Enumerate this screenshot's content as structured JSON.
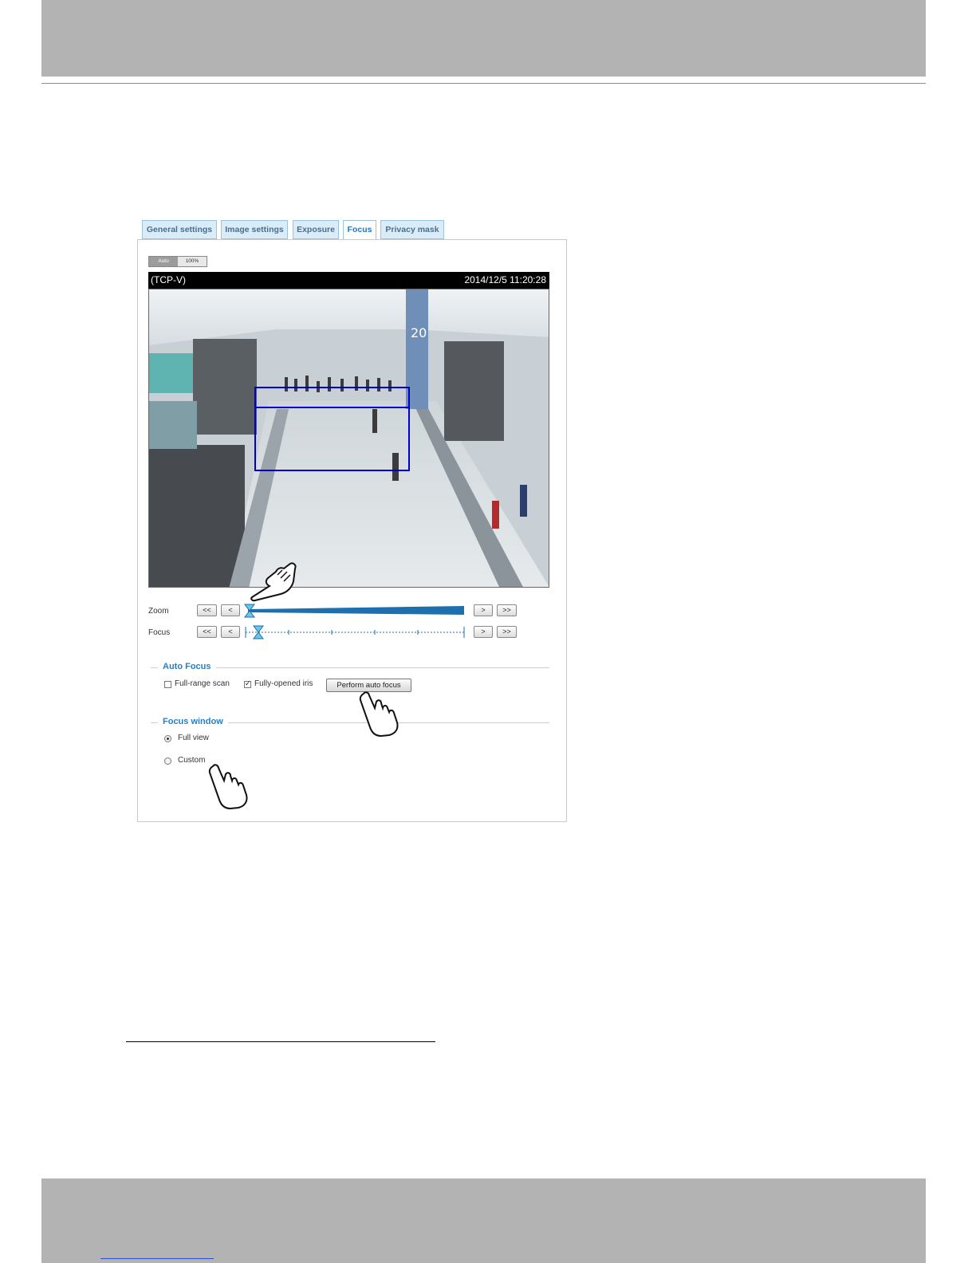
{
  "tabs": [
    {
      "label": "General settings",
      "active": false
    },
    {
      "label": "Image settings",
      "active": false
    },
    {
      "label": "Exposure",
      "active": false
    },
    {
      "label": "Focus",
      "active": true
    },
    {
      "label": "Privacy mask",
      "active": false
    }
  ],
  "view_toggle": {
    "auto_label": "Auto",
    "full_label": "100%"
  },
  "stream": {
    "protocol": "(TCP-V)",
    "timestamp": "2014/12/5 11:20:28"
  },
  "controls": {
    "zoom": {
      "label": "Zoom",
      "far_left": "<<",
      "left": "<",
      "right": ">",
      "far_right": ">>",
      "level": 0.0
    },
    "focus": {
      "label": "Focus",
      "far_left": "<<",
      "left": "<",
      "right": ">",
      "far_right": ">>",
      "level": 0.06
    }
  },
  "auto_focus": {
    "title": "Auto Focus",
    "full_range_scan": {
      "label": "Full-range scan",
      "checked": false
    },
    "fully_opened_iris": {
      "label": "Fully-opened iris",
      "checked": true
    },
    "button_label": "Perform auto focus"
  },
  "focus_window": {
    "title": "Focus window",
    "options": [
      {
        "label": "Full view",
        "selected": true
      },
      {
        "label": "Custom",
        "selected": false
      }
    ]
  },
  "colors": {
    "tab_active_text": "#1f7ac8",
    "section_title": "#2a7fc0",
    "focus_window_box": "#0000cc"
  },
  "icons": [
    "hand-pointer-icon"
  ]
}
